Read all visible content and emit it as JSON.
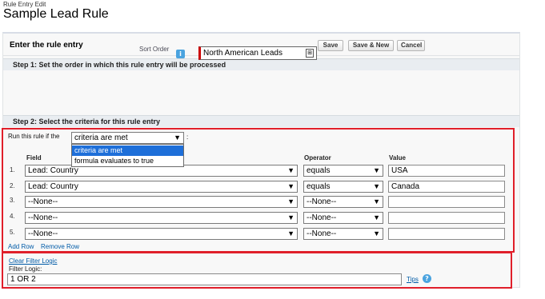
{
  "header": {
    "pre_title": "Rule Entry Edit",
    "title": "Sample Lead Rule"
  },
  "panel": {
    "title": "Enter the rule entry",
    "buttons": {
      "save": "Save",
      "save_new": "Save & New",
      "cancel": "Cancel"
    }
  },
  "step1": {
    "heading": "Step 1: Set the order in which this rule entry will be processed",
    "sort_order_label": "Sort Order",
    "sort_order_value": "North American Leads",
    "info_icon": "i"
  },
  "step2": {
    "heading": "Step 2: Select the criteria for this rule entry",
    "run_label": "Run this rule if the",
    "run_select_value": "criteria are met",
    "run_suffix": ":",
    "dropdown_options": [
      "criteria are met",
      "formula evaluates to true"
    ],
    "columns": {
      "field": "Field",
      "operator": "Operator",
      "value": "Value"
    },
    "rows": [
      {
        "num": "1.",
        "field": "Lead: Country",
        "operator": "equals",
        "value": "USA"
      },
      {
        "num": "2.",
        "field": "Lead: Country",
        "operator": "equals",
        "value": "Canada"
      },
      {
        "num": "3.",
        "field": "--None--",
        "operator": "--None--",
        "value": ""
      },
      {
        "num": "4.",
        "field": "--None--",
        "operator": "--None--",
        "value": ""
      },
      {
        "num": "5.",
        "field": "--None--",
        "operator": "--None--",
        "value": ""
      }
    ],
    "add_row": "Add Row",
    "remove_row": "Remove Row"
  },
  "filter_logic": {
    "clear_link": "Clear Filter Logic",
    "label": "Filter Logic:",
    "value": "1 OR 2",
    "tips": "Tips",
    "help_icon": "?"
  },
  "colors": {
    "required": "#cc0000",
    "highlight": "#e01f2a",
    "link": "#015ba7",
    "selected": "#1e6fd9"
  }
}
